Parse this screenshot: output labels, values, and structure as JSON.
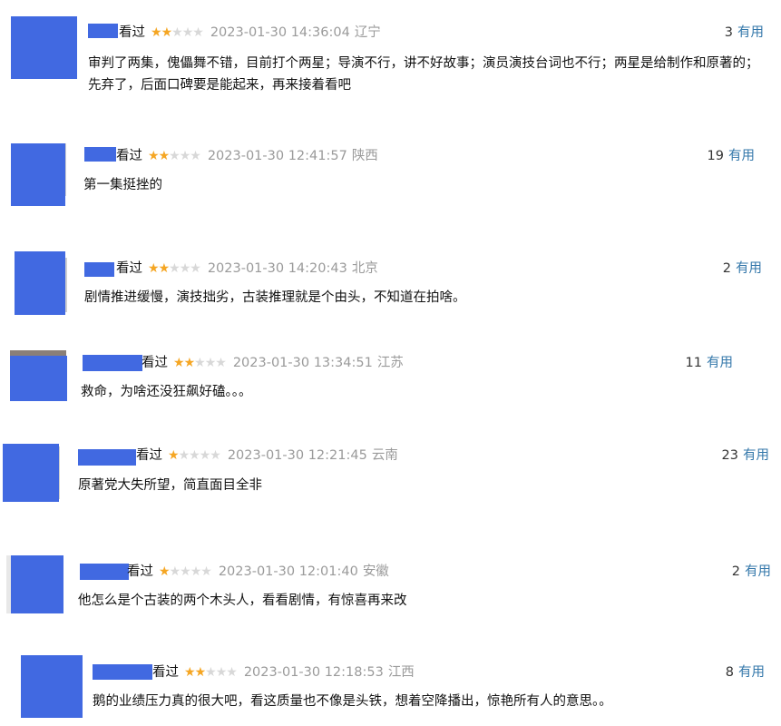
{
  "reviews": [
    {
      "status": "看过",
      "rating": 2,
      "time": "2023-01-30 14:36:04",
      "location": "辽宁",
      "useful_count": "3",
      "useful_label": "有用",
      "content": "审判了两集，傀儡舞不错，目前打个两星；导演不行，讲不好故事；演员演技台词也不行；两星是给制作和原著的；先弃了，后面口碑要是能起来，再来接着看吧"
    },
    {
      "status": "看过",
      "rating": 2,
      "time": "2023-01-30 12:41:57",
      "location": "陕西",
      "useful_count": "19",
      "useful_label": "有用",
      "content": "第一集挺挫的"
    },
    {
      "status": "看过",
      "rating": 2,
      "time": "2023-01-30 14:20:43",
      "location": "北京",
      "useful_count": "2",
      "useful_label": "有用",
      "content": "剧情推进缓慢，演技拙劣，古装推理就是个由头，不知道在拍啥。"
    },
    {
      "status": "看过",
      "rating": 2,
      "time": "2023-01-30 13:34:51",
      "location": "江苏",
      "useful_count": "11",
      "useful_label": "有用",
      "content": "救命，为啥还没狂飙好磕。。。"
    },
    {
      "status": "看过",
      "rating": 1,
      "time": "2023-01-30 12:21:45",
      "location": "云南",
      "useful_count": "23",
      "useful_label": "有用",
      "content": "原著党大失所望，简直面目全非"
    },
    {
      "status": "看过",
      "rating": 1,
      "time": "2023-01-30 12:01:40",
      "location": "安徽",
      "useful_count": "2",
      "useful_label": "有用",
      "content": "他怎么是个古装的两个木头人，看看剧情，有惊喜再来改"
    },
    {
      "status": "看过",
      "rating": 2,
      "time": "2023-01-30 12:18:53",
      "location": "江西",
      "useful_count": "8",
      "useful_label": "有用",
      "content": "鹅的业绩压力真的很大吧，看这质量也不像是头铁，想着空降播出，惊艳所有人的意思。。"
    }
  ],
  "colors": {
    "avatar_placeholder": "#4169e1",
    "star_on": "#f5a623",
    "star_off": "#d8d8d8",
    "meta_gray": "#9a9a9a",
    "link_blue": "#3377aa"
  }
}
